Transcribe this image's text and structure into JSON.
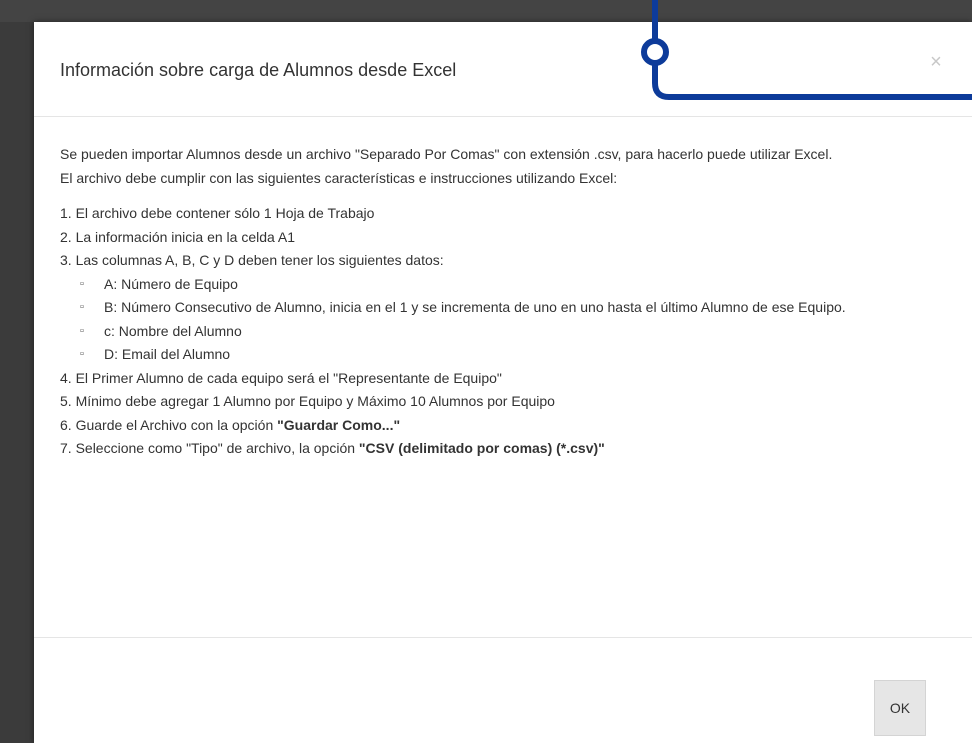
{
  "dialog": {
    "title": "Información sobre carga de Alumnos desde Excel",
    "close_glyph": "×",
    "intro_line_1": "Se pueden importar Alumnos desde un archivo \"Separado Por Comas\" con extensión .csv, para hacerlo puede utilizar Excel.",
    "intro_line_2": "El archivo debe cumplir con las siguientes características e instrucciones utilizando Excel:",
    "steps": [
      "1. El archivo debe contener sólo 1 Hoja de Trabajo",
      "2. La información inicia en la celda A1",
      "3. Las columnas A, B, C y D deben tener los siguientes datos:"
    ],
    "sub_bullet": "▫",
    "sub_items": [
      "A: Número de Equipo",
      "B: Número Consecutivo de Alumno, inicia en el 1 y se incrementa de uno en uno hasta el último Alumno de ese Equipo.",
      "c: Nombre del Alumno",
      "D: Email del Alumno"
    ],
    "steps_after": [
      "4. El Primer Alumno de cada equipo será el \"Representante de Equipo\"",
      "5. Mínimo debe agregar 1 Alumno por Equipo y Máximo 10 Alumnos por Equipo"
    ],
    "step6_prefix": "6. Guarde el Archivo con la opción ",
    "step6_bold": "\"Guardar Como...\"",
    "step7_prefix": "7. Seleccione como \"Tipo\" de archivo, la opción ",
    "step7_bold": "\"CSV (delimitado por comas) (*.csv)\"",
    "ok_label": "OK"
  },
  "colors": {
    "callout": "#0d3b9a",
    "backdrop": "#3b3b3b"
  }
}
